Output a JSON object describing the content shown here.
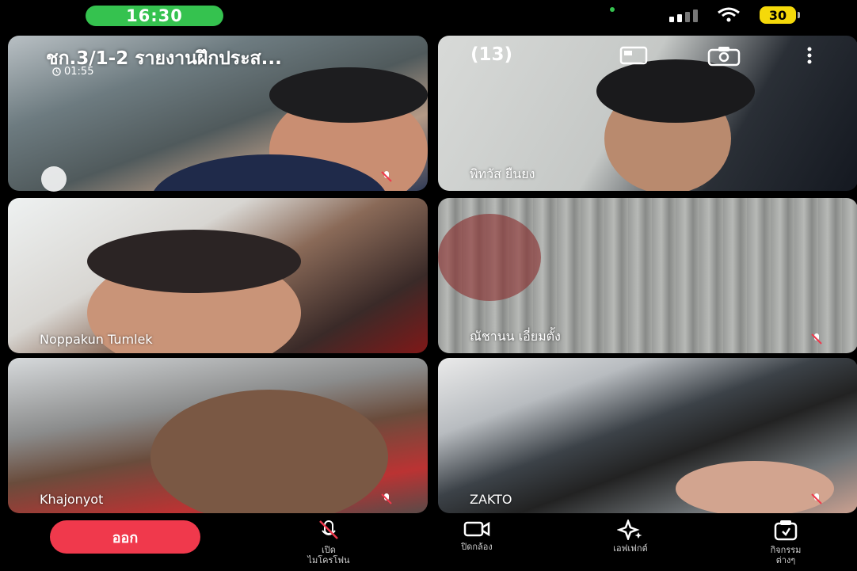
{
  "status_bar": {
    "time": "16:30",
    "battery": "30"
  },
  "call": {
    "title": "ชก.3/1-2 รายงานฝึกประส...",
    "participant_count": "(13)",
    "duration": "01:55"
  },
  "participants": [
    {
      "name": ""
    },
    {
      "name": "พิทวัส ยืนยง"
    },
    {
      "name": "Noppakun Tumlek"
    },
    {
      "name": "ณัชานน เอี่ยมตั้ง"
    },
    {
      "name": "Khajonyot"
    },
    {
      "name": "ZAKTO"
    }
  ],
  "controls": {
    "leave": "ออก",
    "mic_line1": "เปิด",
    "mic_line2": "ไมโครโฟน",
    "camera": "ปิดกล้อง",
    "effects": "เอฟเฟกต์",
    "activities_line1": "กิจกรรม",
    "activities_line2": "ต่างๆ"
  }
}
